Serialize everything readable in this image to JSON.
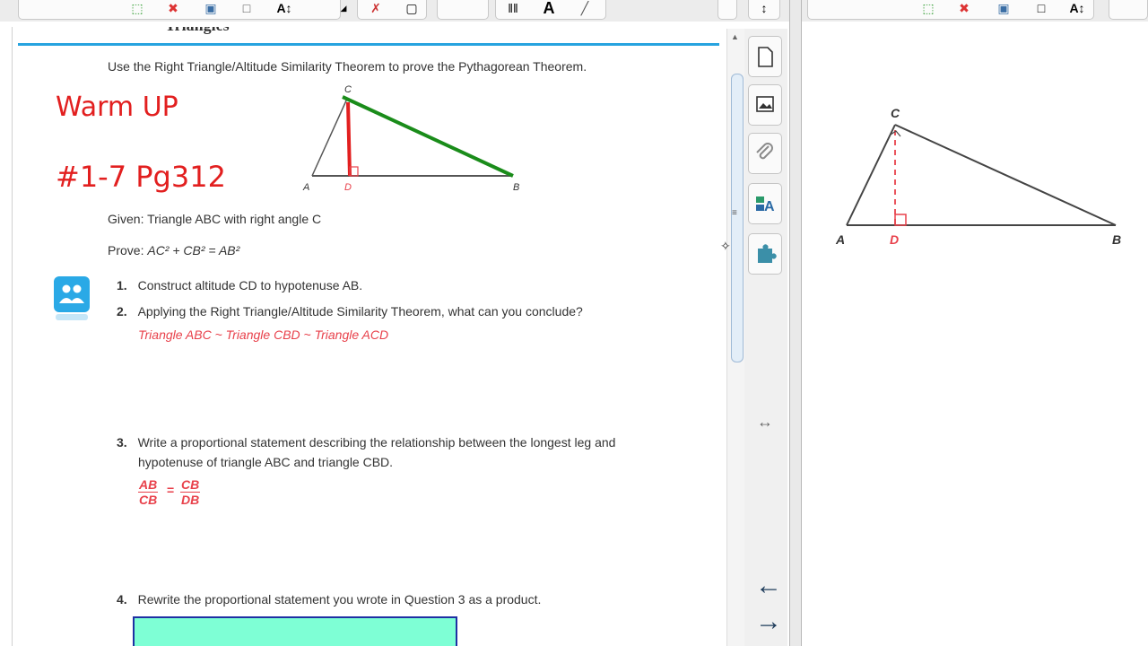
{
  "doc": {
    "header_cut_text": "Triangles",
    "instruction": "Use the Right Triangle/Altitude Similarity Theorem to prove the Pythagorean Theorem.",
    "warm_up": "Warm UP",
    "assignment": "#1-7 Pg312",
    "given": "Given: Triangle ABC with right angle C",
    "prove_prefix": "Prove:",
    "prove_expr": "AC² + CB² = AB²",
    "q1_num": "1.",
    "q1_text": "Construct altitude CD to hypotenuse AB.",
    "q2_num": "2.",
    "q2_text": "Applying the Right Triangle/Altitude Similarity Theorem, what can you conclude?",
    "q2_answer": "Triangle ABC ~ Triangle CBD ~ Triangle ACD",
    "q3_num": "3.",
    "q3_text_line1": "Write a proportional statement describing the relationship between the longest leg and",
    "q3_text_line2": "hypotenuse of triangle ABC and triangle CBD.",
    "q3_frac1_num": "AB",
    "q3_frac1_den": "CB",
    "q3_eq": "=",
    "q3_frac2_num": "CB",
    "q3_frac2_den": "DB",
    "q4_num": "4.",
    "q4_text": "Rewrite the proportional statement you wrote in Question 3 as a product."
  },
  "diagram_left": {
    "label_c": "C",
    "label_a": "A",
    "label_d": "D",
    "label_b": "B"
  },
  "diagram_right": {
    "label_c": "C",
    "label_a": "A",
    "label_d": "D",
    "label_b": "B"
  },
  "toolbar": {
    "text_tool": "A"
  },
  "side_tabs": [
    "page-sorter",
    "gallery",
    "attachments",
    "properties",
    "add-ons"
  ],
  "colors": {
    "accent_line": "#27a3df",
    "handwriting": "#e21f1f",
    "answer": "#e8414b",
    "green_pen": "#1a8c1a",
    "green_box": "#7effd5"
  }
}
